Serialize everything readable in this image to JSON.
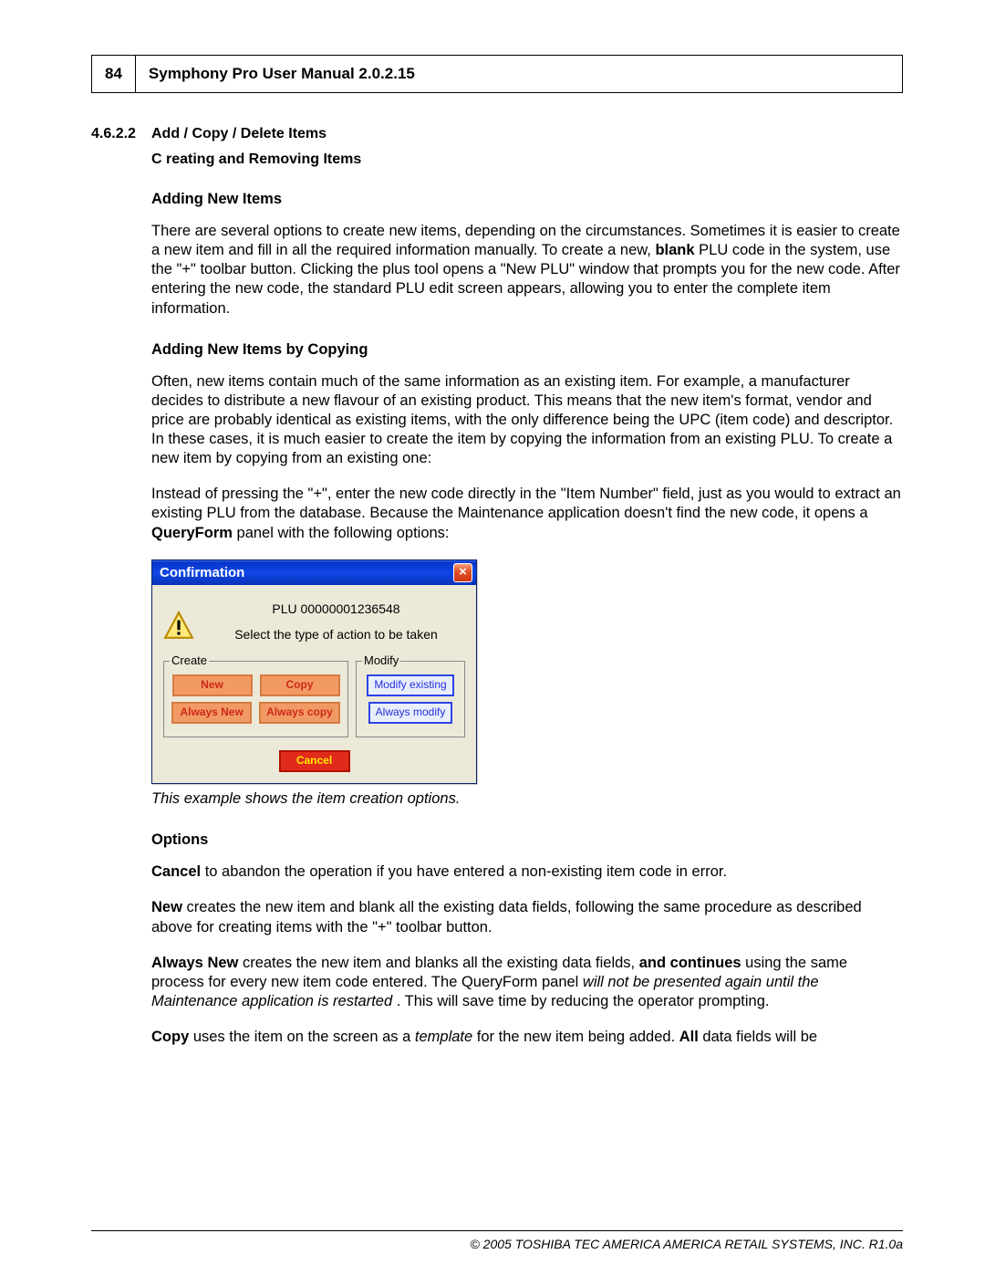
{
  "header": {
    "page_number": "84",
    "doc_title": "Symphony Pro User Manual  2.0.2.15"
  },
  "section": {
    "number": "4.6.2.2",
    "title": "Add / Copy / Delete Items",
    "subtitle": "C reating and Removing Items"
  },
  "body": {
    "h_adding_new": "Adding New Items",
    "p_adding_new_1a": " There are several options to create new items, depending on the circumstances. Sometimes it is easier to create a new item and fill in all the required information manually. To create a new, ",
    "p_adding_new_1b_bold": "blank",
    "p_adding_new_1c": " PLU code in the system, use the \"+\" toolbar button. Clicking the plus tool opens a \"New PLU\" window that prompts you for the new code. After entering the new code, the standard PLU edit screen appears, allowing you to enter the complete item information.",
    "h_adding_copy": "Adding New Items by Copying",
    "p_copy_1": " Often, new items contain much of the same information as an existing item. For example, a manufacturer decides to distribute a new flavour of an existing product. This means that the new item's format, vendor and price are probably identical as existing items, with the only difference being the UPC (item code) and descriptor. In these cases, it is much easier to create the item by copying the information from an existing PLU. To create a new item by copying from an existing one:",
    "p_copy_2a": " Instead of pressing the \"+\", enter the new code directly in the \"Item Number\" field, just as you would to extract an existing PLU from the database. Because the Maintenance application doesn't find the new code, it opens a ",
    "p_copy_2b_bold": "QueryForm",
    "p_copy_2c": "  panel with the following options:",
    "caption": "This example shows the item creation options.",
    "h_options": "Options",
    "p_cancel_a": "Cancel",
    "p_cancel_b": "  to abandon the operation if you have entered a non-existing item code in error.",
    "p_new_a": "New",
    "p_new_b": "  creates the new item and blank all the existing data fields, following the same procedure as described above for creating items with the \"+\" toolbar button.",
    "p_alwaysnew_a": "Always New",
    "p_alwaysnew_b": "  creates the new item and blanks all the existing data fields, ",
    "p_alwaysnew_c": "and  continues",
    "p_alwaysnew_d": "  using the same process for every new item code entered. The QueryForm panel ",
    "p_alwaysnew_e": "will not be presented  again until the Maintenance application is restarted",
    "p_alwaysnew_f": " . This will save time by reducing the operator prompting.",
    "p_copyopt_a": " Copy",
    "p_copyopt_b": "  uses the item on the screen as a ",
    "p_copyopt_c": "template",
    "p_copyopt_d": "  for the new item being added. ",
    "p_copyopt_e": "All",
    "p_copyopt_f": "  data fields will be"
  },
  "dialog": {
    "title": "Confirmation",
    "close_glyph": "×",
    "plu_line": "PLU 00000001236548",
    "instruction": "Select the type of action to be taken",
    "legend_create": "Create",
    "legend_modify": "Modify",
    "btn_new": "New",
    "btn_copy": "Copy",
    "btn_always_new": "Always New",
    "btn_always_copy": "Always copy",
    "btn_modify_existing": "Modify existing",
    "btn_always_modify": "Always modify",
    "btn_cancel": "Cancel"
  },
  "footer": {
    "copyright": "© 2005 TOSHIBA TEC AMERICA AMERICA RETAIL SYSTEMS, INC.   R1.0a"
  }
}
